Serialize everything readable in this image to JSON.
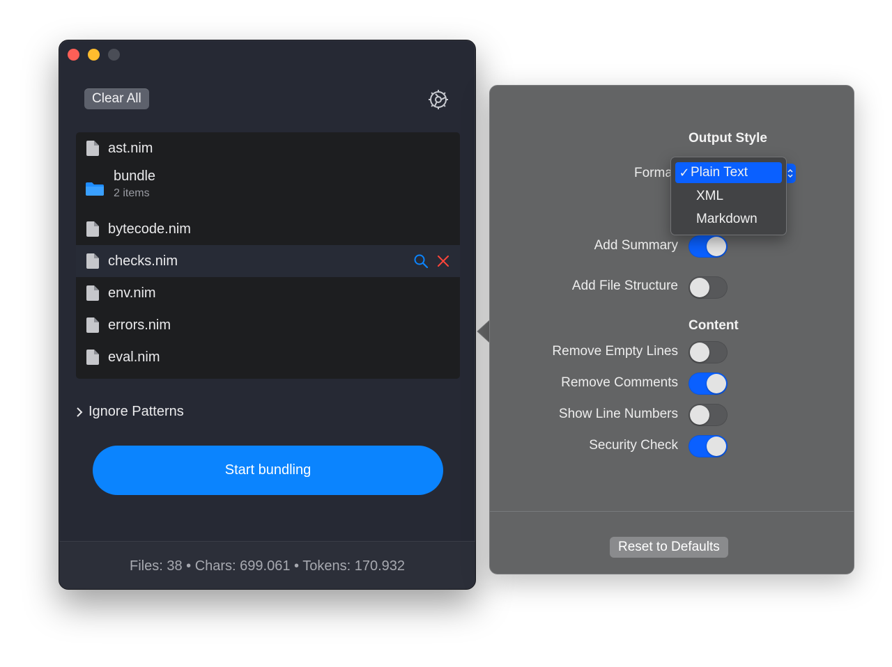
{
  "main": {
    "clear_all_label": "Clear All",
    "files": [
      {
        "name": "ast.nim",
        "type": "file"
      },
      {
        "name": "bundle",
        "type": "folder",
        "subtitle": "2 items"
      },
      {
        "name": "bytecode.nim",
        "type": "file"
      },
      {
        "name": "checks.nim",
        "type": "file",
        "selected": true
      },
      {
        "name": "env.nim",
        "type": "file"
      },
      {
        "name": "errors.nim",
        "type": "file"
      },
      {
        "name": "eval.nim",
        "type": "file"
      }
    ],
    "ignore_patterns_label": "Ignore Patterns",
    "start_label": "Start bundling",
    "footer_stats": "Files: 38 • Chars: 699.061 • Tokens: 170.932"
  },
  "settings": {
    "output_style_title": "Output Style",
    "format_label": "Format",
    "format_options": [
      "Plain Text",
      "XML",
      "Markdown"
    ],
    "format_selected": "Plain Text",
    "check_mark": "✓",
    "add_summary_label": "Add Summary",
    "add_summary_on": true,
    "add_file_structure_label": "Add File Structure",
    "add_file_structure_on": false,
    "content_title": "Content",
    "remove_empty_lines_label": "Remove Empty Lines",
    "remove_empty_lines_on": false,
    "remove_comments_label": "Remove Comments",
    "remove_comments_on": true,
    "show_line_numbers_label": "Show Line Numbers",
    "show_line_numbers_on": false,
    "security_check_label": "Security Check",
    "security_check_on": true,
    "reset_label": "Reset to Defaults"
  },
  "colors": {
    "accent": "#0b84fe",
    "toggle_on": "#0a60ff",
    "close_x": "#ff453a"
  },
  "icons": [
    "gear-icon",
    "file-icon",
    "folder-icon",
    "search-icon",
    "close-icon",
    "chevron-right-icon"
  ]
}
